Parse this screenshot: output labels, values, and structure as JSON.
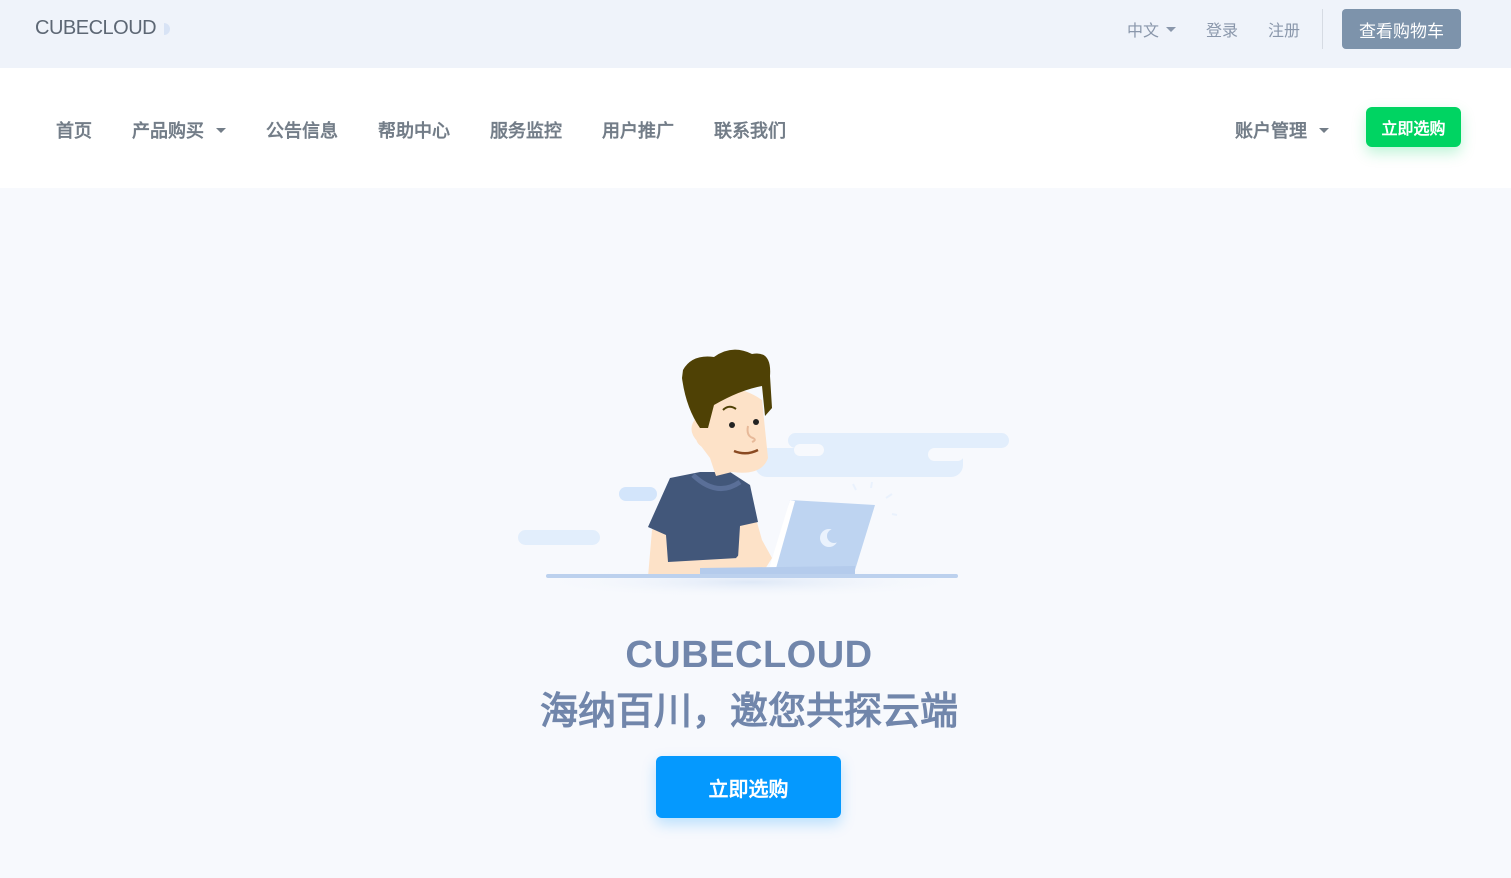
{
  "topbar": {
    "logo_text": "CUBECLOUD",
    "language": "中文",
    "login": "登录",
    "register": "注册",
    "cart_button": "查看购物车"
  },
  "nav": {
    "items": [
      {
        "label": "首页",
        "dropdown": false
      },
      {
        "label": "产品购买",
        "dropdown": true
      },
      {
        "label": "公告信息",
        "dropdown": false
      },
      {
        "label": "帮助中心",
        "dropdown": false
      },
      {
        "label": "服务监控",
        "dropdown": false
      },
      {
        "label": "用户推广",
        "dropdown": false
      },
      {
        "label": "联系我们",
        "dropdown": false
      }
    ],
    "account": "账户管理",
    "buy_button": "立即选购"
  },
  "hero": {
    "title": "CUBECLOUD",
    "subtitle": "海纳百川，邀您共探云端",
    "cta_button": "立即选购",
    "illustration": "person-with-laptop-illustration"
  },
  "colors": {
    "primary_blue": "#0599fe",
    "accent_green": "#00d462",
    "cart_gray": "#7d93ab",
    "hero_text": "#7186ab"
  }
}
